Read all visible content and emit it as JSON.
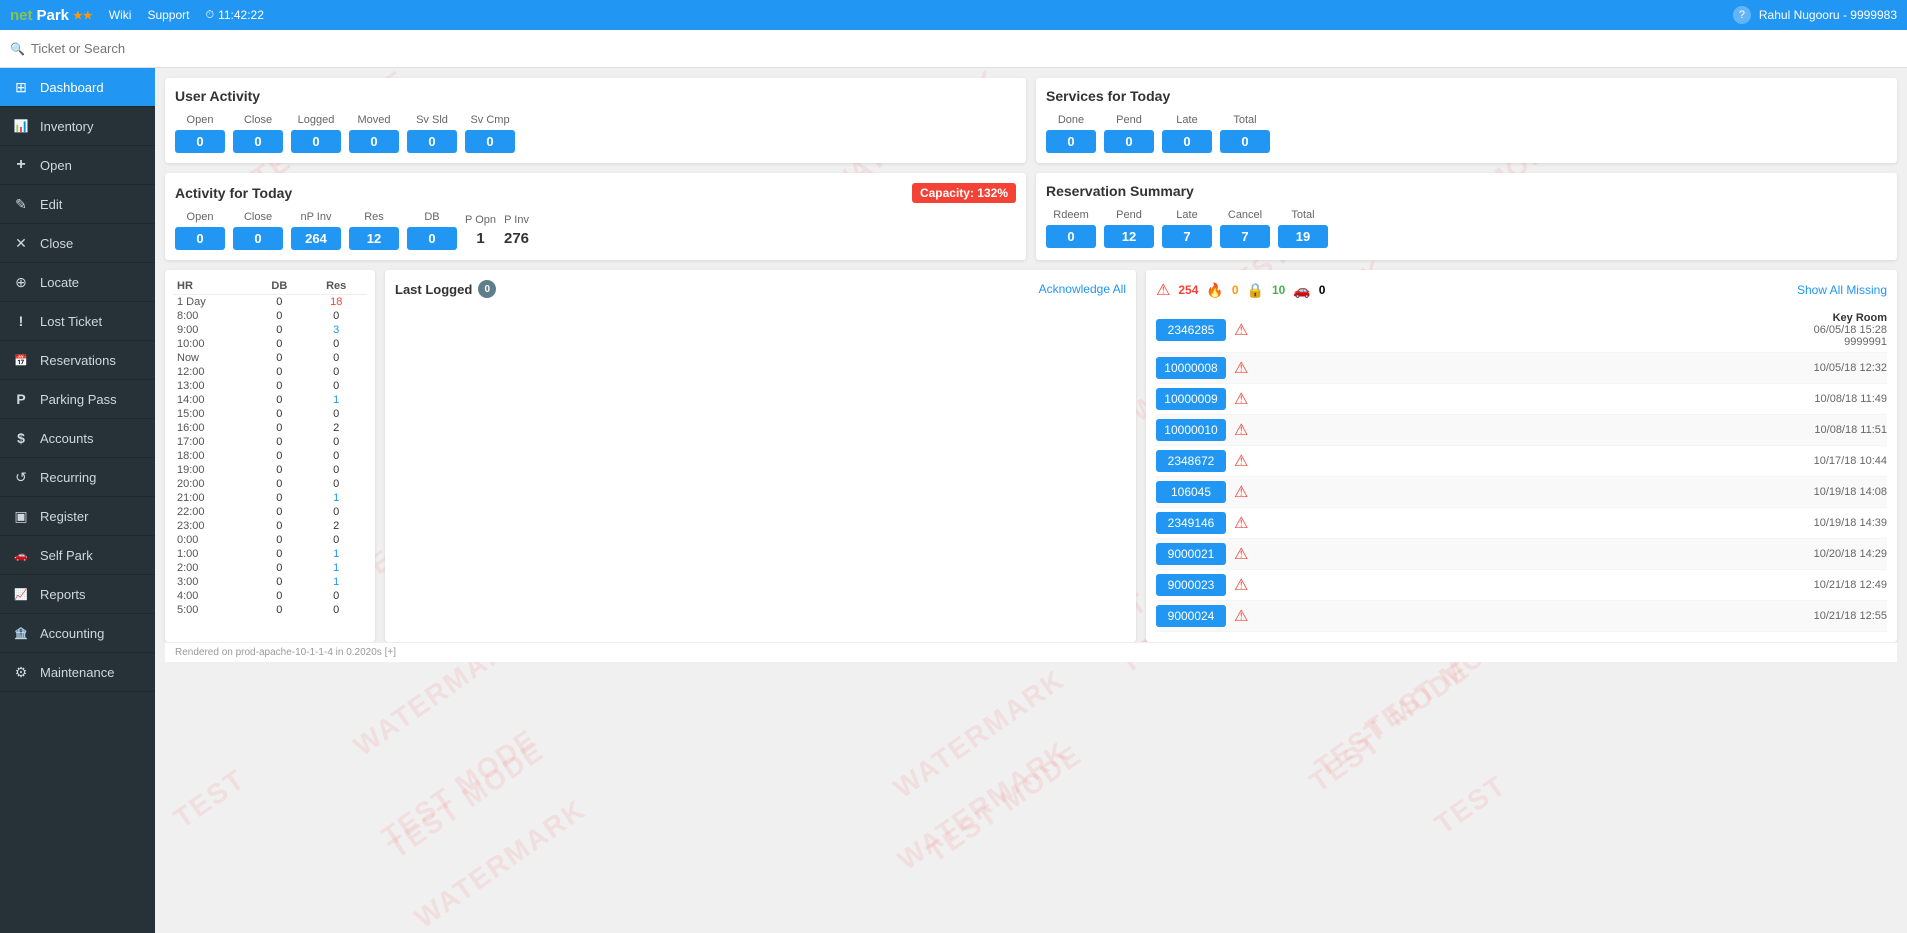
{
  "topnav": {
    "logo_net": "net",
    "logo_park": "Park",
    "wiki": "Wiki",
    "support": "Support",
    "time": "11:42:22",
    "help": "?",
    "user": "Rahul Nugooru - 9999983"
  },
  "search": {
    "placeholder": "Ticket or Search"
  },
  "sidebar": {
    "items": [
      {
        "id": "dashboard",
        "label": "Dashboard",
        "icon": "dashboard",
        "active": true
      },
      {
        "id": "inventory",
        "label": "Inventory",
        "icon": "inventory",
        "active": false
      },
      {
        "id": "open",
        "label": "Open",
        "icon": "open",
        "active": false
      },
      {
        "id": "edit",
        "label": "Edit",
        "icon": "edit",
        "active": false
      },
      {
        "id": "close",
        "label": "Close",
        "icon": "close",
        "active": false
      },
      {
        "id": "locate",
        "label": "Locate",
        "icon": "locate",
        "active": false
      },
      {
        "id": "lost-ticket",
        "label": "Lost Ticket",
        "icon": "lost",
        "active": false
      },
      {
        "id": "reservations",
        "label": "Reservations",
        "icon": "reservations",
        "active": false
      },
      {
        "id": "parking-pass",
        "label": "Parking Pass",
        "icon": "parking",
        "active": false
      },
      {
        "id": "accounts",
        "label": "Accounts",
        "icon": "accounts",
        "active": false
      },
      {
        "id": "recurring",
        "label": "Recurring",
        "icon": "recurring",
        "active": false
      },
      {
        "id": "register",
        "label": "Register",
        "icon": "register",
        "active": false
      },
      {
        "id": "self-park",
        "label": "Self Park",
        "icon": "selfpark",
        "active": false
      },
      {
        "id": "reports",
        "label": "Reports",
        "icon": "reports",
        "active": false
      },
      {
        "id": "accounting",
        "label": "Accounting",
        "icon": "accounting",
        "active": false
      },
      {
        "id": "maintenance",
        "label": "Maintenance",
        "icon": "maintenance",
        "active": false
      }
    ]
  },
  "user_activity": {
    "title": "User Activity",
    "stats": [
      {
        "label": "Open",
        "value": "0"
      },
      {
        "label": "Close",
        "value": "0"
      },
      {
        "label": "Logged",
        "value": "0"
      },
      {
        "label": "Moved",
        "value": "0"
      },
      {
        "label": "Sv Sld",
        "value": "0"
      },
      {
        "label": "Sv Cmp",
        "value": "0"
      }
    ]
  },
  "services_today": {
    "title": "Services for Today",
    "stats": [
      {
        "label": "Done",
        "value": "0"
      },
      {
        "label": "Pend",
        "value": "0"
      },
      {
        "label": "Late",
        "value": "0"
      },
      {
        "label": "Total",
        "value": "0"
      }
    ]
  },
  "activity_today": {
    "title": "Activity for Today",
    "capacity_label": "Capacity: 132%",
    "stats": [
      {
        "label": "Open",
        "value": "0",
        "type": "box"
      },
      {
        "label": "Close",
        "value": "0",
        "type": "box"
      },
      {
        "label": "nP Inv",
        "value": "264",
        "type": "box"
      },
      {
        "label": "Res",
        "value": "12",
        "type": "box"
      },
      {
        "label": "DB",
        "value": "0",
        "type": "box"
      },
      {
        "label": "P Opn",
        "value": "1",
        "type": "plain"
      },
      {
        "label": "P Inv",
        "value": "276",
        "type": "plain"
      }
    ]
  },
  "reservation_summary": {
    "title": "Reservation Summary",
    "stats": [
      {
        "label": "Rdeem",
        "value": "0"
      },
      {
        "label": "Pend",
        "value": "12"
      },
      {
        "label": "Late",
        "value": "7"
      },
      {
        "label": "Cancel",
        "value": "7"
      },
      {
        "label": "Total",
        "value": "19"
      }
    ]
  },
  "last_logged": {
    "title": "Last Logged",
    "count": "0",
    "ack_label": "Acknowledge All"
  },
  "alerts": {
    "red_count": "254",
    "orange_count": "0",
    "green_count": "10",
    "car_count": "0",
    "show_missing": "Show All Missing",
    "items": [
      {
        "ticket": "2346285",
        "has_alert": true,
        "info": "Key Room",
        "info2": "06/05/18 15:28",
        "info3": "9999991",
        "alt": false
      },
      {
        "ticket": "10000008",
        "has_alert": true,
        "info": "",
        "info2": "10/05/18 12:32",
        "info3": "",
        "alt": true
      },
      {
        "ticket": "10000009",
        "has_alert": true,
        "info": "",
        "info2": "10/08/18 11:49",
        "info3": "",
        "alt": false
      },
      {
        "ticket": "10000010",
        "has_alert": true,
        "info": "",
        "info2": "10/08/18 11:51",
        "info3": "",
        "alt": true
      },
      {
        "ticket": "2348672",
        "has_alert": true,
        "info": "",
        "info2": "10/17/18 10:44",
        "info3": "",
        "alt": false
      },
      {
        "ticket": "106045",
        "has_alert": true,
        "info": "",
        "info2": "10/19/18 14:08",
        "info3": "",
        "alt": true
      },
      {
        "ticket": "2349146",
        "has_alert": true,
        "info": "",
        "info2": "10/19/18 14:39",
        "info3": "",
        "alt": false
      },
      {
        "ticket": "9000021",
        "has_alert": true,
        "info": "",
        "info2": "10/20/18 14:29",
        "info3": "",
        "alt": true
      },
      {
        "ticket": "9000023",
        "has_alert": true,
        "info": "",
        "info2": "10/21/18 12:49",
        "info3": "",
        "alt": false
      },
      {
        "ticket": "9000024",
        "has_alert": true,
        "info": "",
        "info2": "10/21/18 12:55",
        "info3": "",
        "alt": true
      }
    ]
  },
  "schedule": {
    "headers": [
      "HR",
      "DB",
      "Res"
    ],
    "rows": [
      {
        "time": "1 Day",
        "db": "0",
        "res": "18",
        "res_color": "red"
      },
      {
        "time": "8:00",
        "db": "0",
        "res": "0",
        "res_color": ""
      },
      {
        "time": "9:00",
        "db": "0",
        "res": "3",
        "res_color": "blue"
      },
      {
        "time": "10:00",
        "db": "0",
        "res": "0",
        "res_color": ""
      },
      {
        "time": "Now",
        "db": "0",
        "res": "0",
        "res_color": ""
      },
      {
        "time": "12:00",
        "db": "0",
        "res": "0",
        "res_color": ""
      },
      {
        "time": "13:00",
        "db": "0",
        "res": "0",
        "res_color": ""
      },
      {
        "time": "14:00",
        "db": "0",
        "res": "1",
        "res_color": "blue"
      },
      {
        "time": "15:00",
        "db": "0",
        "res": "0",
        "res_color": ""
      },
      {
        "time": "16:00",
        "db": "0",
        "res": "2",
        "res_color": ""
      },
      {
        "time": "17:00",
        "db": "0",
        "res": "0",
        "res_color": ""
      },
      {
        "time": "18:00",
        "db": "0",
        "res": "0",
        "res_color": ""
      },
      {
        "time": "19:00",
        "db": "0",
        "res": "0",
        "res_color": ""
      },
      {
        "time": "20:00",
        "db": "0",
        "res": "0",
        "res_color": ""
      },
      {
        "time": "21:00",
        "db": "0",
        "res": "1",
        "res_color": "blue"
      },
      {
        "time": "22:00",
        "db": "0",
        "res": "0",
        "res_color": ""
      },
      {
        "time": "23:00",
        "db": "0",
        "res": "2",
        "res_color": ""
      },
      {
        "time": "0:00",
        "db": "0",
        "res": "0",
        "res_color": ""
      },
      {
        "time": "1:00",
        "db": "0",
        "res": "1",
        "res_color": "blue"
      },
      {
        "time": "2:00",
        "db": "0",
        "res": "1",
        "res_color": "blue"
      },
      {
        "time": "3:00",
        "db": "0",
        "res": "1",
        "res_color": "blue"
      },
      {
        "time": "4:00",
        "db": "0",
        "res": "0",
        "res_color": ""
      },
      {
        "time": "5:00",
        "db": "0",
        "res": "0",
        "res_color": ""
      }
    ]
  },
  "footer": {
    "text": "Rendered on prod-apache-10-1-1-4 in 0.2020s [+]"
  }
}
